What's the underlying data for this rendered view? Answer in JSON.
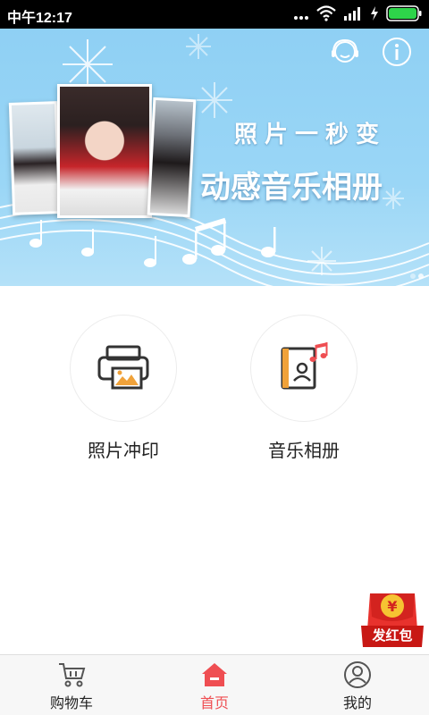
{
  "status_bar": {
    "time": "中午12:17"
  },
  "banner": {
    "title_line1": "照片一秒变",
    "title_line2": "动感音乐相册",
    "slide_count": 2,
    "active_slide": 2
  },
  "features": [
    {
      "label": "照片冲印",
      "icon": "printer-icon"
    },
    {
      "label": "音乐相册",
      "icon": "music-album-icon"
    }
  ],
  "red_packet": {
    "label": "发红包",
    "symbol": "¥"
  },
  "tab_bar": {
    "tabs": [
      {
        "label": "购物车",
        "icon": "cart-icon",
        "active": false
      },
      {
        "label": "首页",
        "icon": "home-icon",
        "active": true
      },
      {
        "label": "我的",
        "icon": "profile-icon",
        "active": false
      }
    ]
  },
  "colors": {
    "accent": "#ef4e52",
    "banner_bg": "#9ad6f6",
    "icon_orange": "#f0a23a",
    "icon_dark": "#333333"
  }
}
